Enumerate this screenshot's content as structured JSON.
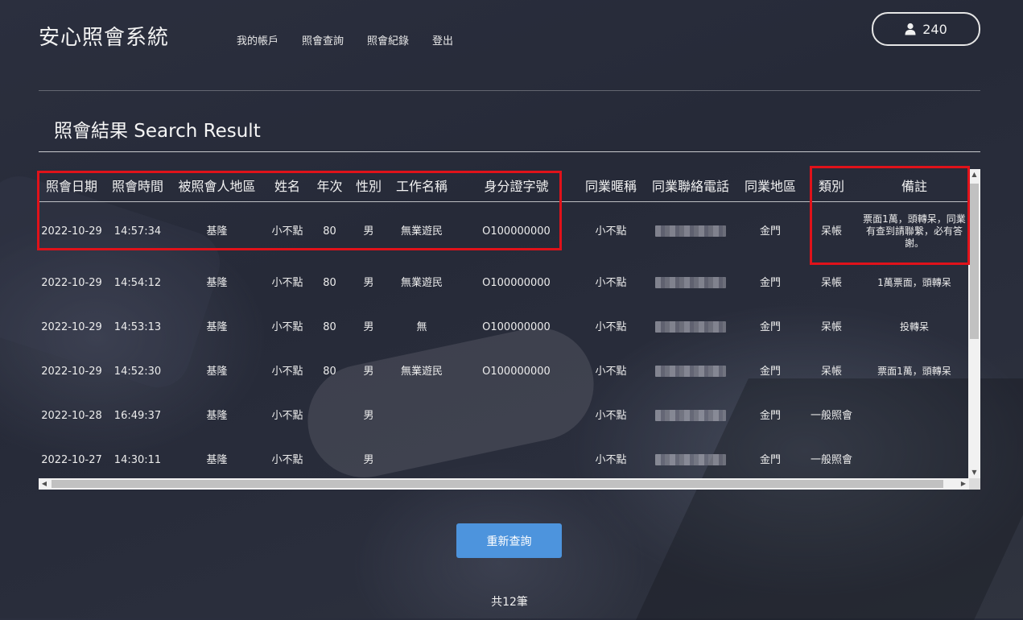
{
  "header": {
    "logo": "安心照會系統",
    "nav": [
      {
        "label": "我的帳戶"
      },
      {
        "label": "照會查詢"
      },
      {
        "label": "照會紀錄"
      },
      {
        "label": "登出"
      }
    ],
    "points": "240"
  },
  "page": {
    "title": "照會結果 Search Result"
  },
  "table": {
    "columns": [
      "照會日期",
      "照會時間",
      "被照會人地區",
      "姓名",
      "年次",
      "性別",
      "工作名稱",
      "身分證字號",
      "同業暱稱",
      "同業聯絡電話",
      "同業地區",
      "類別",
      "備註"
    ],
    "rows": [
      {
        "date": "2022-10-29",
        "time": "14:57:34",
        "region": "基隆",
        "name": "小不點",
        "year": "80",
        "gender": "男",
        "job": "無業遊民",
        "id": "O100000000",
        "nick": "小不點",
        "phone": "",
        "peer_region": "金門",
        "category": "呆帳",
        "note": "票面1萬，頭轉呆，同業有查到請聯繫，必有答謝。"
      },
      {
        "date": "2022-10-29",
        "time": "14:54:12",
        "region": "基隆",
        "name": "小不點",
        "year": "80",
        "gender": "男",
        "job": "無業遊民",
        "id": "O100000000",
        "nick": "小不點",
        "phone": "",
        "peer_region": "金門",
        "category": "呆帳",
        "note": "1萬票面，頭轉呆"
      },
      {
        "date": "2022-10-29",
        "time": "14:53:13",
        "region": "基隆",
        "name": "小不點",
        "year": "80",
        "gender": "男",
        "job": "無",
        "id": "O100000000",
        "nick": "小不點",
        "phone": "",
        "peer_region": "金門",
        "category": "呆帳",
        "note": "投轉呆"
      },
      {
        "date": "2022-10-29",
        "time": "14:52:30",
        "region": "基隆",
        "name": "小不點",
        "year": "80",
        "gender": "男",
        "job": "無業遊民",
        "id": "O100000000",
        "nick": "小不點",
        "phone": "",
        "peer_region": "金門",
        "category": "呆帳",
        "note": "票面1萬，頭轉呆"
      },
      {
        "date": "2022-10-28",
        "time": "16:49:37",
        "region": "基隆",
        "name": "小不點",
        "year": "",
        "gender": "男",
        "job": "",
        "id": "",
        "nick": "小不點",
        "phone": "",
        "peer_region": "金門",
        "category": "一般照會",
        "note": ""
      },
      {
        "date": "2022-10-27",
        "time": "14:30:11",
        "region": "基隆",
        "name": "小不點",
        "year": "",
        "gender": "男",
        "job": "",
        "id": "",
        "nick": "小不點",
        "phone": "",
        "peer_region": "金門",
        "category": "一般照會",
        "note": ""
      }
    ]
  },
  "actions": {
    "requery": "重新查詢"
  },
  "footer": {
    "total": "共12筆"
  },
  "icons": {
    "points": "user-icon",
    "scroll_up": "triangle-up-icon",
    "scroll_down": "triangle-down-icon",
    "scroll_left": "triangle-left-icon",
    "scroll_right": "triangle-right-icon"
  },
  "colors": {
    "highlight_box": "#e0121a",
    "button": "#4d94dd"
  }
}
